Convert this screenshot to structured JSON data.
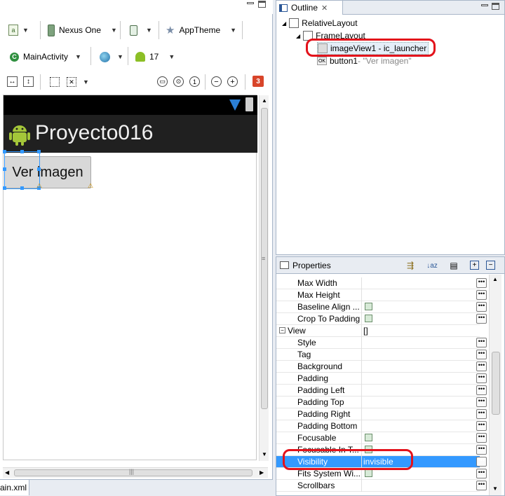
{
  "toolbar": {
    "device": "Nexus One",
    "theme": "AppTheme",
    "activity": "MainActivity",
    "api_level": "17",
    "error_count": "3"
  },
  "preview": {
    "app_title": "Proyecto016",
    "button_label": "Ver imagen"
  },
  "editor_tab": {
    "label": "ain.xml"
  },
  "outline": {
    "tab_label": "Outline",
    "items": [
      {
        "label": "RelativeLayout"
      },
      {
        "label": "FrameLayout"
      },
      {
        "label": "imageView1 - ic_launcher"
      },
      {
        "label": "button1",
        "sub": " - \"Ver imagen\""
      }
    ]
  },
  "properties": {
    "tab_label": "Properties",
    "rows": [
      {
        "name": "Max Width",
        "value": ""
      },
      {
        "name": "Max Height",
        "value": ""
      },
      {
        "name": "Baseline Align ...",
        "value": ""
      },
      {
        "name": "Crop To Padding",
        "value": ""
      },
      {
        "name": "View",
        "value": "[]"
      },
      {
        "name": "Style",
        "value": ""
      },
      {
        "name": "Tag",
        "value": ""
      },
      {
        "name": "Background",
        "value": ""
      },
      {
        "name": "Padding",
        "value": ""
      },
      {
        "name": "Padding Left",
        "value": ""
      },
      {
        "name": "Padding Top",
        "value": ""
      },
      {
        "name": "Padding Right",
        "value": ""
      },
      {
        "name": "Padding Bottom",
        "value": ""
      },
      {
        "name": "Focusable",
        "value": ""
      },
      {
        "name": "Focusable In T...",
        "value": ""
      },
      {
        "name": "Visibility",
        "value": "invisible"
      },
      {
        "name": "Fits System Wi...",
        "value": ""
      },
      {
        "name": "Scrollbars",
        "value": ""
      }
    ]
  },
  "colors": {
    "selection": "#3399ff",
    "highlight_ring": "#e3121b"
  }
}
